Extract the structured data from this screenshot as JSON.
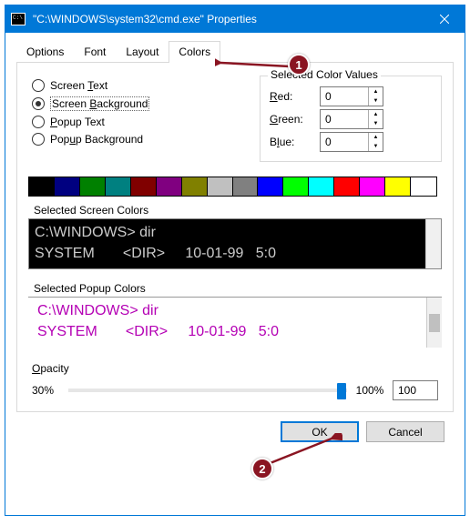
{
  "titlebar": {
    "title": "\"C:\\WINDOWS\\system32\\cmd.exe\" Properties"
  },
  "tabs": {
    "options": "Options",
    "font": "Font",
    "layout": "Layout",
    "colors": "Colors"
  },
  "radios": {
    "screen_text": "Screen Text",
    "screen_background": "Screen Background",
    "popup_text": "Popup Text",
    "popup_background": "Popup Background"
  },
  "rgb": {
    "group_title": "Selected Color Values",
    "red_label": "Red:",
    "green_label": "Green:",
    "blue_label": "Blue:",
    "red": "0",
    "green": "0",
    "blue": "0"
  },
  "palette": [
    "#000000",
    "#000080",
    "#008000",
    "#008080",
    "#800000",
    "#800080",
    "#808000",
    "#c0c0c0",
    "#808080",
    "#0000ff",
    "#00ff00",
    "#00ffff",
    "#ff0000",
    "#ff00ff",
    "#ffff00",
    "#ffffff"
  ],
  "selected_swatch": 0,
  "preview": {
    "screen_label": "Selected Screen Colors",
    "popup_label": "Selected Popup Colors",
    "line1": "C:\\WINDOWS> dir",
    "line2": "SYSTEM       <DIR>     10-01-99   5:0"
  },
  "opacity": {
    "label": "Opacity",
    "min": "30%",
    "max": "100%",
    "value": "100",
    "thumb_percent": 98
  },
  "footer": {
    "ok": "OK",
    "cancel": "Cancel"
  },
  "annotations": {
    "one": "1",
    "two": "2"
  }
}
